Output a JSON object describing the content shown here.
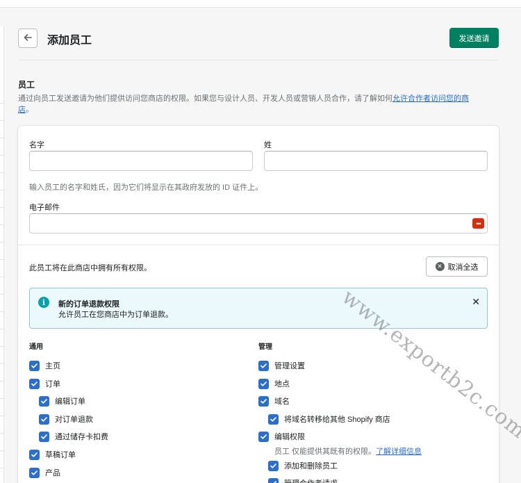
{
  "header": {
    "title": "添加员工",
    "send_invite": "发送邀请"
  },
  "section": {
    "title": "员工",
    "desc_before": "通过向员工发送邀请为他们提供访问您商店的权限。如果您与设计人员、开发人员或营销人员合作，请了解如何",
    "desc_link": "允许合作者访问您的商店",
    "desc_after": "。"
  },
  "form": {
    "first_name_label": "名字",
    "last_name_label": "姓",
    "name_help": "输入员工的名字和姓氏，因为它们将显示在其政府发放的 ID 证件上。",
    "email_label": "电子邮件",
    "first_name_value": "",
    "last_name_value": "",
    "email_value": ""
  },
  "permissions": {
    "summary": "此员工将在此商店中拥有所有权限。",
    "deselect_all": "取消全选",
    "banner": {
      "title": "新的订单退款权限",
      "subtitle": "允许员工在您商店中为订单退款。"
    },
    "general": {
      "heading": "通用",
      "items": [
        {
          "label": "主页",
          "checked": true
        },
        {
          "label": "订单",
          "checked": true
        },
        {
          "label": "编辑订单",
          "checked": true
        },
        {
          "label": "对订单退款",
          "checked": true
        },
        {
          "label": "通过储存卡扣费",
          "checked": true
        },
        {
          "label": "草稿订单",
          "checked": true
        },
        {
          "label": "产品",
          "checked": true
        }
      ]
    },
    "admin": {
      "heading": "管理",
      "items": [
        {
          "label": "管理设置",
          "checked": true
        },
        {
          "label": "地点",
          "checked": true
        },
        {
          "label": "域名",
          "checked": true
        },
        {
          "label": "将域名转移给其他 Shopify 商店",
          "checked": true
        },
        {
          "label": "编辑权限",
          "checked": true
        },
        {
          "label": "添加和删除员工",
          "checked": true
        },
        {
          "label": "管理合作者请求",
          "checked": true
        }
      ],
      "note_text": "员工 仅能提供其既有的权限。",
      "note_link": "了解详细信息"
    }
  },
  "watermark": "www.exportb2c.com",
  "colors": {
    "primary": "#008060",
    "checkbox": "#2c6ecb",
    "banner_bg": "#ebf9fc",
    "info": "#00a0ac"
  }
}
